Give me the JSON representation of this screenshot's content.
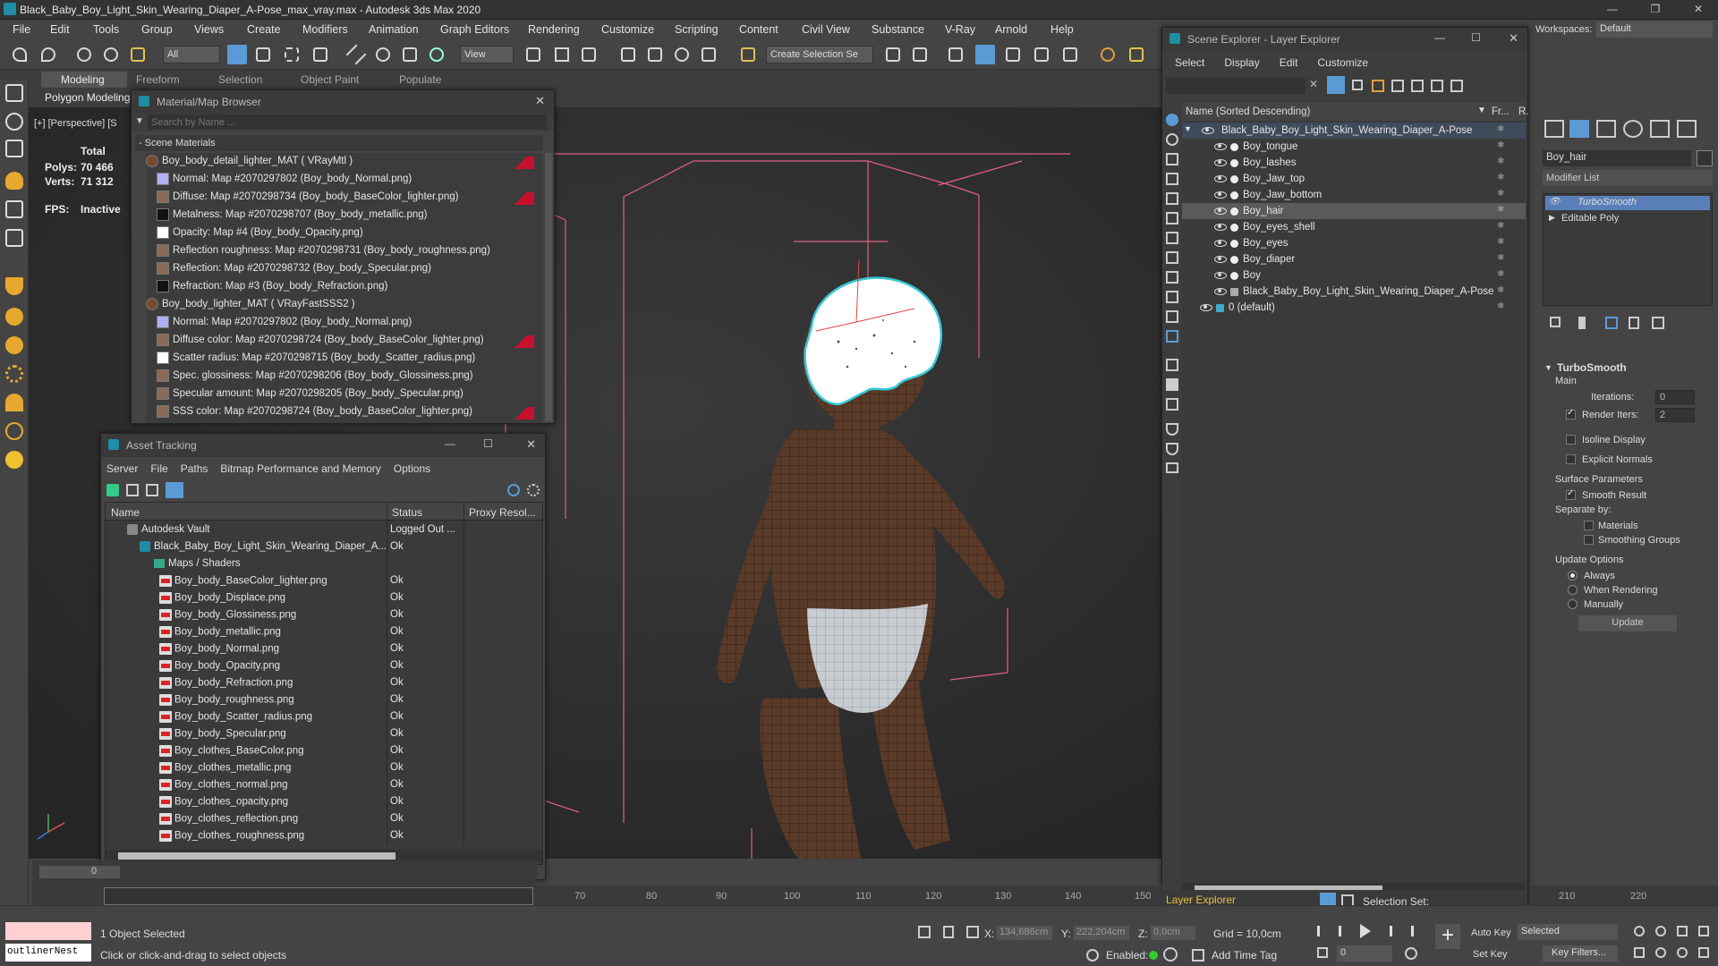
{
  "window": {
    "title": "Black_Baby_Boy_Light_Skin_Wearing_Diaper_A-Pose_max_vray.max - Autodesk 3ds Max 2020"
  },
  "menu": [
    "File",
    "Edit",
    "Tools",
    "Group",
    "Views",
    "Create",
    "Modifiers",
    "Animation",
    "Graph Editors",
    "Rendering",
    "Customize",
    "Scripting",
    "Content",
    "Civil View",
    "Substance",
    "V-Ray",
    "Arnold",
    "Help"
  ],
  "workspaces": {
    "label": "Workspaces:",
    "value": "Default"
  },
  "toolbar": {
    "filter": "All",
    "view": "View",
    "selection_set": "Create Selection Se"
  },
  "ribbon": {
    "tabs": [
      "Modeling",
      "Freeform",
      "Selection",
      "Object Paint",
      "Populate"
    ],
    "sub": "Polygon Modeling"
  },
  "viewport": {
    "label": "[+] [Perspective] [S",
    "total_label": "Total",
    "polys_label": "Polys:",
    "polys": "70 466",
    "verts_label": "Verts:",
    "verts": "71 312",
    "fps_label": "FPS:",
    "fps": "Inactive"
  },
  "material_browser": {
    "title": "Material/Map Browser",
    "search_placeholder": "Search by Name ...",
    "section": "- Scene Materials",
    "items": [
      {
        "text": "Boy_body_detail_lighter_MAT ( VRayMtl )",
        "flag": true
      },
      {
        "text": "Normal: Map #2070297802 (Boy_body_Normal.png)"
      },
      {
        "text": "Diffuse: Map #2070298734 (Boy_body_BaseColor_lighter.png)",
        "flag": true
      },
      {
        "text": "Metalness: Map #2070298707 (Boy_body_metallic.png)"
      },
      {
        "text": "Opacity: Map #4 (Boy_body_Opacity.png)"
      },
      {
        "text": "Reflection roughness: Map #2070298731 (Boy_body_roughness.png)"
      },
      {
        "text": "Reflection: Map #2070298732 (Boy_body_Specular.png)"
      },
      {
        "text": "Refraction: Map #3 (Boy_body_Refraction.png)"
      },
      {
        "text": "Boy_body_lighter_MAT ( VRayFastSSS2 )"
      },
      {
        "text": "Normal: Map #2070297802 (Boy_body_Normal.png)"
      },
      {
        "text": "Diffuse color: Map #2070298724 (Boy_body_BaseColor_lighter.png)",
        "flag": true
      },
      {
        "text": "Scatter radius: Map #2070298715 (Boy_body_Scatter_radius.png)"
      },
      {
        "text": "Spec. glossiness: Map #2070298206 (Boy_body_Glossiness.png)"
      },
      {
        "text": "Specular amount: Map #2070298205 (Boy_body_Specular.png)"
      },
      {
        "text": "SSS color: Map #2070298724 (Boy_body_BaseColor_lighter.png)",
        "flag": true
      }
    ]
  },
  "asset_tracking": {
    "title": "Asset Tracking",
    "menu": [
      "Server",
      "File",
      "Paths",
      "Bitmap Performance and Memory",
      "Options"
    ],
    "columns": [
      "Name",
      "Status",
      "Proxy Resol..."
    ],
    "rows": [
      {
        "name": "Autodesk Vault",
        "status": "Logged Out ..."
      },
      {
        "name": "Black_Baby_Boy_Light_Skin_Wearing_Diaper_A...",
        "status": "Ok"
      },
      {
        "name": "Maps / Shaders",
        "status": ""
      },
      {
        "name": "Boy_body_BaseColor_lighter.png",
        "status": "Ok"
      },
      {
        "name": "Boy_body_Displace.png",
        "status": "Ok"
      },
      {
        "name": "Boy_body_Glossiness.png",
        "status": "Ok"
      },
      {
        "name": "Boy_body_metallic.png",
        "status": "Ok"
      },
      {
        "name": "Boy_body_Normal.png",
        "status": "Ok"
      },
      {
        "name": "Boy_body_Opacity.png",
        "status": "Ok"
      },
      {
        "name": "Boy_body_Refraction.png",
        "status": "Ok"
      },
      {
        "name": "Boy_body_roughness.png",
        "status": "Ok"
      },
      {
        "name": "Boy_body_Scatter_radius.png",
        "status": "Ok"
      },
      {
        "name": "Boy_body_Specular.png",
        "status": "Ok"
      },
      {
        "name": "Boy_clothes_BaseColor.png",
        "status": "Ok"
      },
      {
        "name": "Boy_clothes_metallic.png",
        "status": "Ok"
      },
      {
        "name": "Boy_clothes_normal.png",
        "status": "Ok"
      },
      {
        "name": "Boy_clothes_opacity.png",
        "status": "Ok"
      },
      {
        "name": "Boy_clothes_reflection.png",
        "status": "Ok"
      },
      {
        "name": "Boy_clothes_roughness.png",
        "status": "Ok"
      }
    ]
  },
  "scene_explorer": {
    "title": "Scene Explorer - Layer Explorer",
    "menu": [
      "Select",
      "Display",
      "Edit",
      "Customize"
    ],
    "col_name": "Name (Sorted Descending)",
    "col_fr": "Fr...",
    "col_r": "R.",
    "items": [
      {
        "name": "Black_Baby_Boy_Light_Skin_Wearing_Diaper_A-Pose",
        "level": 1,
        "selected": false,
        "top": true
      },
      {
        "name": "Boy_tongue",
        "level": 2
      },
      {
        "name": "Boy_lashes",
        "level": 2
      },
      {
        "name": "Boy_Jaw_top",
        "level": 2
      },
      {
        "name": "Boy_Jaw_bottom",
        "level": 2
      },
      {
        "name": "Boy_hair",
        "level": 2,
        "selected": true
      },
      {
        "name": "Boy_eyes_shell",
        "level": 2
      },
      {
        "name": "Boy_eyes",
        "level": 2
      },
      {
        "name": "Boy_diaper",
        "level": 2
      },
      {
        "name": "Boy",
        "level": 2
      },
      {
        "name": "Black_Baby_Boy_Light_Skin_Wearing_Diaper_A-Pose",
        "level": 2
      },
      {
        "name": "0 (default)",
        "level": 0
      }
    ],
    "footer_label": "Layer Explorer",
    "selection_set_label": "Selection Set:"
  },
  "command_panel": {
    "object_name": "Boy_hair",
    "modifier_list": "Modifier List",
    "stack": [
      "TurboSmooth",
      "Editable Poly"
    ],
    "rollout_title": "TurboSmooth",
    "main_label": "Main",
    "iterations_label": "Iterations:",
    "iterations": "0",
    "render_iters_label": "Render Iters:",
    "render_iters": "2",
    "isoline": "Isoline Display",
    "explicit_normals": "Explicit Normals",
    "surface_params": "Surface Parameters",
    "smooth_result": "Smooth Result",
    "separate_by": "Separate by:",
    "materials": "Materials",
    "smoothing_groups": "Smoothing Groups",
    "update_options": "Update Options",
    "always": "Always",
    "when_rendering": "When Rendering",
    "manually": "Manually",
    "update_btn": "Update"
  },
  "timeline": {
    "ticks": [
      "70",
      "80",
      "90",
      "100",
      "110",
      "120",
      "130",
      "140",
      "150",
      "210",
      "220"
    ]
  },
  "status": {
    "script_field": "outlinerNest",
    "selected": "1 Object Selected",
    "prompt": "Click or click-and-drag to select objects",
    "x_label": "X:",
    "x": "134,686cm",
    "y_label": "Y:",
    "y": "222,204cm",
    "z_label": "Z:",
    "z": "0,0cm",
    "grid": "Grid = 10,0cm",
    "enabled": "Enabled:",
    "add_time_tag": "Add Time Tag",
    "auto_key": "Auto Key",
    "set_key": "Set Key",
    "selected_dd": "Selected",
    "key_filters": "Key Filters...",
    "frame": "0",
    "frame_counter": "0"
  },
  "colors": {
    "accent": "#5b9bd5",
    "flag": "#c8102e",
    "selection": "#5a6f8c"
  }
}
